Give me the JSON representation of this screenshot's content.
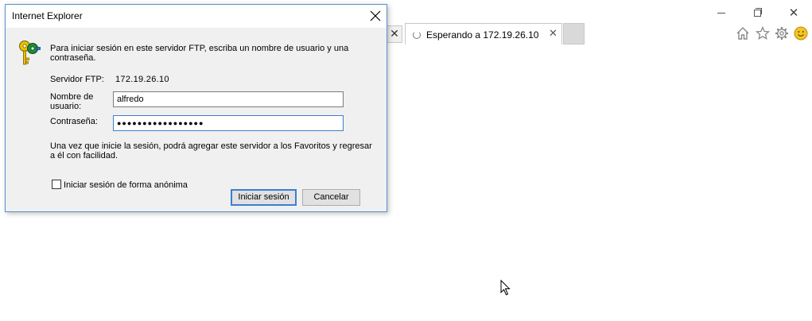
{
  "browser": {
    "tab_title": "Esperando a 172.19.26.10",
    "tab_close": "✕",
    "prev_tab_close": "✕",
    "window_close": "✕",
    "icons": [
      "home-icon",
      "favorites-star-icon",
      "tools-gear-icon",
      "feedback-smiley-icon"
    ]
  },
  "dialog": {
    "title": "Internet Explorer",
    "message": "Para iniciar sesión en este servidor FTP, escriba un nombre de usuario y una contraseña.",
    "server_label": "Servidor FTP:",
    "server_value": "172.19.26.10",
    "user_label": "Nombre de usuario:",
    "user_value": "alfredo",
    "password_label": "Contraseña:",
    "password_value": "●●●●●●●●●●●●●●●●●",
    "info": "Una vez que inicie la sesión, podrá agregar este servidor a los Favoritos y regresar a él con facilidad.",
    "anonymous_label": "Iniciar sesión de forma anónima",
    "anonymous_checked": false,
    "login_button": "Iniciar sesión",
    "cancel_button": "Cancelar"
  },
  "colors": {
    "accent": "#3c7fd1",
    "dialog_bg": "#f0f0f0",
    "button_bg": "#e1e1e1"
  }
}
